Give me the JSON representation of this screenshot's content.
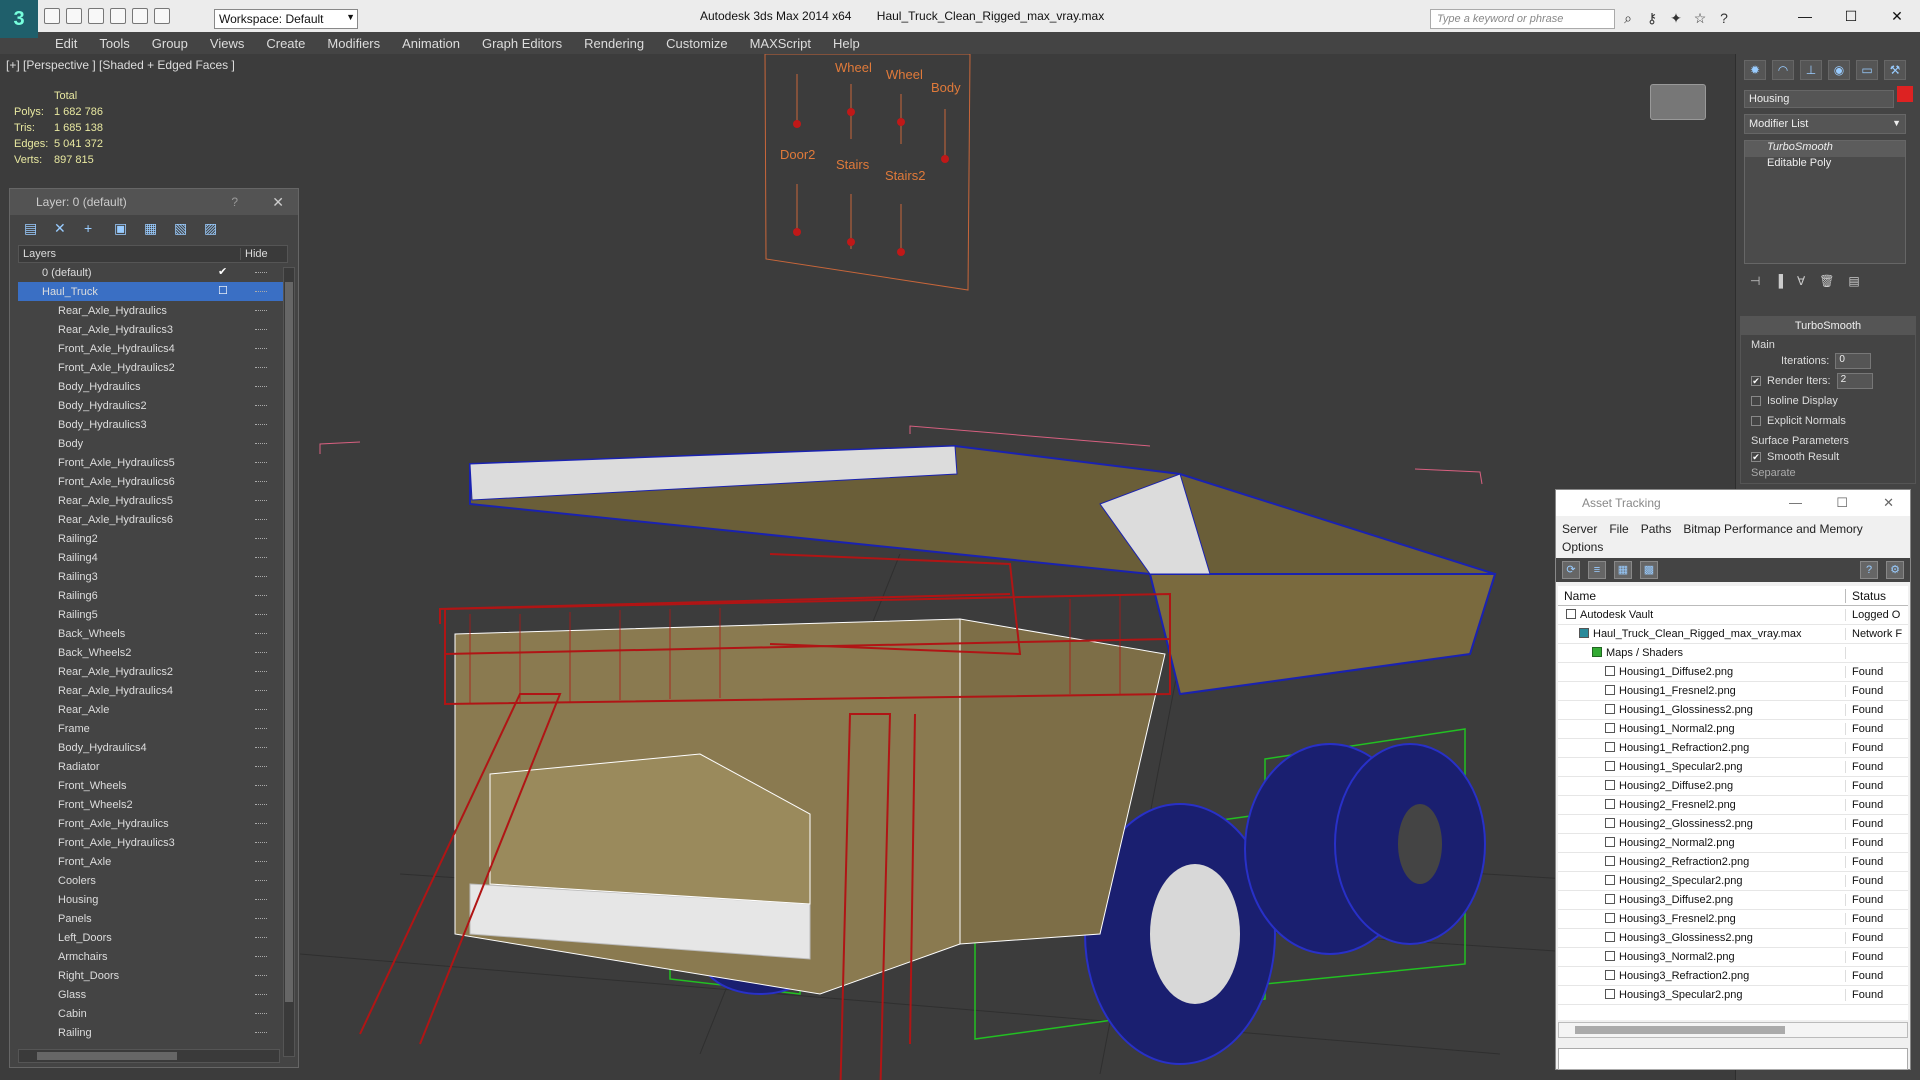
{
  "titlebar": {
    "app_logo": "3",
    "workspace": "Workspace: Default",
    "app_title": "Autodesk 3ds Max  2014 x64",
    "file_name": "Haul_Truck_Clean_Rigged_max_vray.max",
    "search_placeholder": "Type a keyword or phrase"
  },
  "menu": [
    "Edit",
    "Tools",
    "Group",
    "Views",
    "Create",
    "Modifiers",
    "Animation",
    "Graph Editors",
    "Rendering",
    "Customize",
    "MAXScript",
    "Help"
  ],
  "viewport": {
    "label": "[+] [Perspective ] [Shaded + Edged Faces ]",
    "stats": {
      "header": "Total",
      "polys_label": "Polys:",
      "polys": "1 682 786",
      "tris_label": "Tris:",
      "tris": "1 685 138",
      "edges_label": "Edges:",
      "edges": "5 041 372",
      "verts_label": "Verts:",
      "verts": "897 815"
    },
    "rig_labels": [
      "Wheel",
      "Wheel",
      "Body",
      "Door2",
      "Stairs",
      "Stairs2"
    ]
  },
  "layer_panel": {
    "title": "Layer: 0 (default)",
    "help": "?",
    "col_layers": "Layers",
    "col_hide": "Hide",
    "top": [
      {
        "label": "0 (default)",
        "checked": true
      },
      {
        "label": "Haul_Truck",
        "selected": true
      }
    ],
    "items": [
      "Rear_Axle_Hydraulics",
      "Rear_Axle_Hydraulics3",
      "Front_Axle_Hydraulics4",
      "Front_Axle_Hydraulics2",
      "Body_Hydraulics",
      "Body_Hydraulics2",
      "Body_Hydraulics3",
      "Body",
      "Front_Axle_Hydraulics5",
      "Front_Axle_Hydraulics6",
      "Rear_Axle_Hydraulics5",
      "Rear_Axle_Hydraulics6",
      "Railing2",
      "Railing4",
      "Railing3",
      "Railing6",
      "Railing5",
      "Back_Wheels",
      "Back_Wheels2",
      "Rear_Axle_Hydraulics2",
      "Rear_Axle_Hydraulics4",
      "Rear_Axle",
      "Frame",
      "Body_Hydraulics4",
      "Radiator",
      "Front_Wheels",
      "Front_Wheels2",
      "Front_Axle_Hydraulics",
      "Front_Axle_Hydraulics3",
      "Front_Axle",
      "Coolers",
      "Housing",
      "Panels",
      "Left_Doors",
      "Armchairs",
      "Right_Doors",
      "Glass",
      "Cabin",
      "Railing"
    ]
  },
  "command_panel": {
    "object_name": "Housing",
    "modifier_list": "Modifier List",
    "stack": [
      "TurboSmooth",
      "Editable Poly"
    ],
    "rollout_title": "TurboSmooth",
    "main_label": "Main",
    "iterations_label": "Iterations:",
    "iterations": "0",
    "render_iters_label": "Render Iters:",
    "render_iters": "2",
    "isoline_label": "Isoline Display",
    "explicit_label": "Explicit Normals",
    "surface_label": "Surface Parameters",
    "smooth_label": "Smooth Result",
    "separate_label": "Separate"
  },
  "asset_tracking": {
    "title": "Asset Tracking",
    "menu": [
      "Server",
      "File",
      "Paths",
      "Bitmap Performance and Memory"
    ],
    "menu2": "Options",
    "col_name": "Name",
    "col_status": "Status",
    "rows": [
      {
        "name": "Autodesk Vault",
        "status": "Logged O",
        "indent": 0
      },
      {
        "name": "Haul_Truck_Clean_Rigged_max_vray.max",
        "status": "Network F",
        "indent": 1
      },
      {
        "name": "Maps / Shaders",
        "status": "",
        "indent": 2
      },
      {
        "name": "Housing1_Diffuse2.png",
        "status": "Found",
        "indent": 3
      },
      {
        "name": "Housing1_Fresnel2.png",
        "status": "Found",
        "indent": 3
      },
      {
        "name": "Housing1_Glossiness2.png",
        "status": "Found",
        "indent": 3
      },
      {
        "name": "Housing1_Normal2.png",
        "status": "Found",
        "indent": 3
      },
      {
        "name": "Housing1_Refraction2.png",
        "status": "Found",
        "indent": 3
      },
      {
        "name": "Housing1_Specular2.png",
        "status": "Found",
        "indent": 3
      },
      {
        "name": "Housing2_Diffuse2.png",
        "status": "Found",
        "indent": 3
      },
      {
        "name": "Housing2_Fresnel2.png",
        "status": "Found",
        "indent": 3
      },
      {
        "name": "Housing2_Glossiness2.png",
        "status": "Found",
        "indent": 3
      },
      {
        "name": "Housing2_Normal2.png",
        "status": "Found",
        "indent": 3
      },
      {
        "name": "Housing2_Refraction2.png",
        "status": "Found",
        "indent": 3
      },
      {
        "name": "Housing2_Specular2.png",
        "status": "Found",
        "indent": 3
      },
      {
        "name": "Housing3_Diffuse2.png",
        "status": "Found",
        "indent": 3
      },
      {
        "name": "Housing3_Fresnel2.png",
        "status": "Found",
        "indent": 3
      },
      {
        "name": "Housing3_Glossiness2.png",
        "status": "Found",
        "indent": 3
      },
      {
        "name": "Housing3_Normal2.png",
        "status": "Found",
        "indent": 3
      },
      {
        "name": "Housing3_Refraction2.png",
        "status": "Found",
        "indent": 3
      },
      {
        "name": "Housing3_Specular2.png",
        "status": "Found",
        "indent": 3
      }
    ]
  },
  "colors": {
    "selection": "#3a6fc4",
    "wire_red": "#b01515",
    "wire_blue": "#1a22b0",
    "wire_green": "#22c022",
    "body_tan": "#8a7a50"
  }
}
